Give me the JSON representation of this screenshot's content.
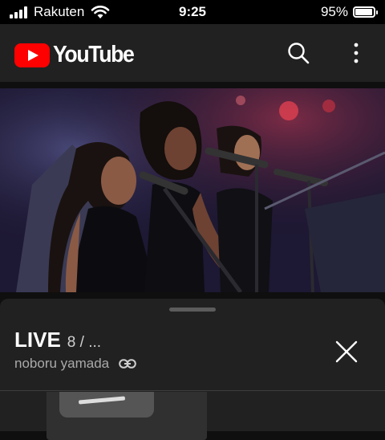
{
  "status_bar": {
    "carrier": "Rakuten",
    "time": "9:25",
    "battery": "95%",
    "battery_level": 0.95
  },
  "app": {
    "logo_text": "YouTube",
    "brand_color": "#ff0000"
  },
  "header": {
    "icons": [
      "search-icon",
      "more-vert-icon"
    ]
  },
  "player": {
    "content": "concert video frame"
  },
  "sheet": {
    "title": "LIVE",
    "count": "8 / ...",
    "channel": "noboru yamada",
    "icons": [
      "link-icon",
      "close-icon"
    ]
  }
}
